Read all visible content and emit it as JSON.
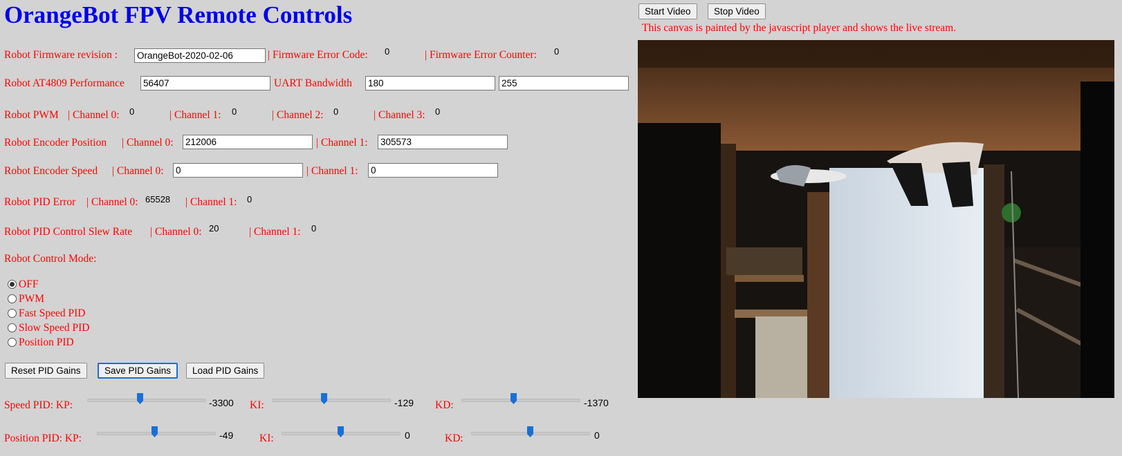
{
  "header": {
    "title": "OrangeBot FPV Remote Controls"
  },
  "video": {
    "start_label": "Start Video",
    "stop_label": "Stop Video",
    "caption": "This canvas is painted by the javascript player and shows the live stream."
  },
  "firmware": {
    "revision_label": "Robot Firmware revision :",
    "revision_value": "OrangeBot-2020-02-06",
    "error_code_label": "| Firmware Error Code:",
    "error_code_value": "0",
    "error_counter_label": "| Firmware Error Counter:",
    "error_counter_value": "0"
  },
  "performance": {
    "label": "Robot AT4809 Performance",
    "value": "56407",
    "uart_label": "UART Bandwidth",
    "uart_value": "180",
    "uart_value2": "255"
  },
  "pwm": {
    "label": "Robot PWM",
    "ch0_label": "| Channel 0:",
    "ch0_value": "0",
    "ch1_label": "| Channel 1:",
    "ch1_value": "0",
    "ch2_label": "| Channel 2:",
    "ch2_value": "0",
    "ch3_label": "| Channel 3:",
    "ch3_value": "0"
  },
  "encoder_position": {
    "label": "Robot Encoder Position",
    "ch0_label": "| Channel 0:",
    "ch0_value": "212006",
    "ch1_label": "| Channel 1:",
    "ch1_value": "305573"
  },
  "encoder_speed": {
    "label": "Robot Encoder Speed",
    "ch0_label": "| Channel 0:",
    "ch0_value": "0",
    "ch1_label": "| Channel 1:",
    "ch1_value": "0"
  },
  "pid_error": {
    "label": "Robot PID Error",
    "ch0_label": "| Channel 0:",
    "ch0_value": "65528",
    "ch1_label": "| Channel 1:",
    "ch1_value": "0"
  },
  "pid_slew": {
    "label": "Robot PID Control Slew Rate",
    "ch0_label": "| Channel 0:",
    "ch0_value": "20",
    "ch1_label": "| Channel 1:",
    "ch1_value": "0"
  },
  "control_mode": {
    "label": "Robot Control Mode:",
    "options": [
      "OFF",
      "PWM",
      "Fast Speed PID",
      "Slow Speed PID",
      "Position PID"
    ],
    "selected": "OFF"
  },
  "pid_buttons": {
    "reset_label": "Reset PID Gains",
    "save_label": "Save PID Gains",
    "load_label": "Load PID Gains"
  },
  "speed_pid": {
    "kp_label": "Speed PID: KP:",
    "kp_value": "-3300",
    "kp_level": 0.45,
    "ki_label": "KI:",
    "ki_value": "-129",
    "ki_level": 0.44,
    "kd_label": "KD:",
    "kd_value": "-1370",
    "kd_level": 0.44
  },
  "position_pid": {
    "kp_label": "Position PID: KP:",
    "kp_value": "-49",
    "kp_level": 0.49,
    "ki_label": "KI:",
    "ki_value": "0",
    "ki_level": 0.5,
    "kd_label": "KD:",
    "kd_value": "0",
    "kd_level": 0.5
  },
  "colors": {
    "title": "#0000ee",
    "label": "#ff0000",
    "background": "#d3d3d3",
    "slider_thumb": "#1a6fd6"
  }
}
